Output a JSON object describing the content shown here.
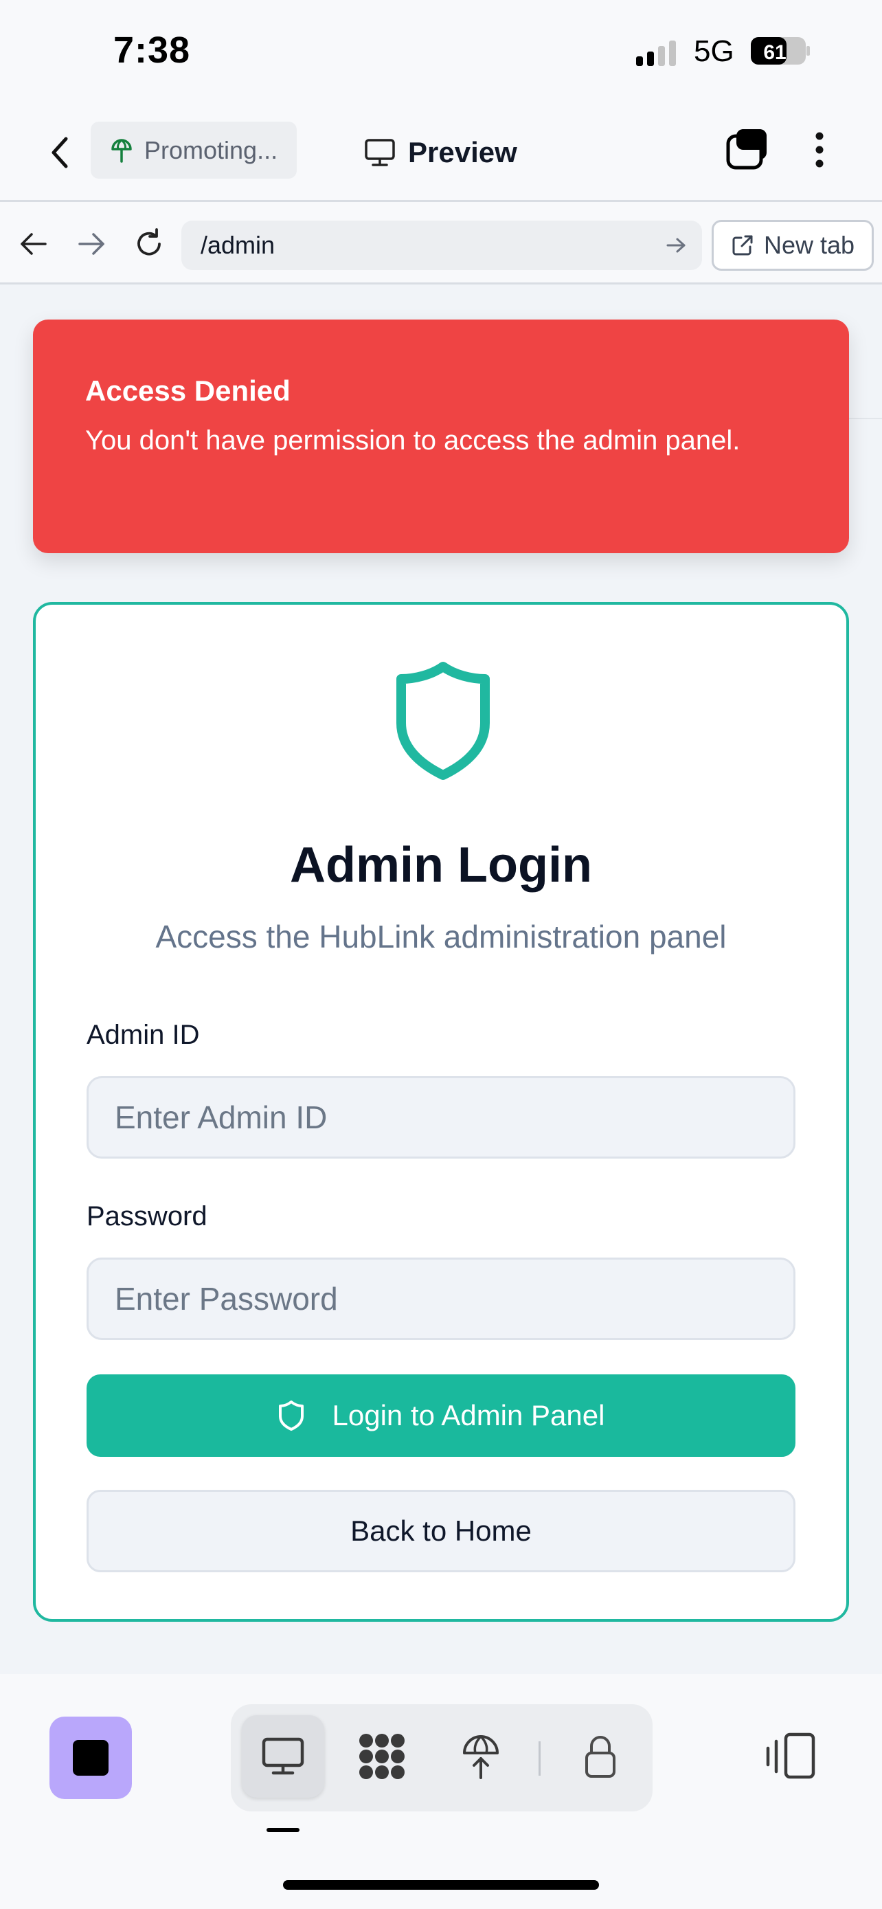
{
  "status_bar": {
    "time": "7:38",
    "network": "5G",
    "battery": "61"
  },
  "header": {
    "project_label": "Promoting...",
    "title": "Preview"
  },
  "browser": {
    "url": "/admin",
    "new_tab_label": "New tab"
  },
  "toast": {
    "title": "Access Denied",
    "message": "You don't have permission to access the admin panel."
  },
  "login": {
    "title": "Admin Login",
    "subtitle": "Access the HubLink administration panel",
    "admin_id_label": "Admin ID",
    "admin_id_placeholder": "Enter Admin ID",
    "admin_id_value": "",
    "password_label": "Password",
    "password_placeholder": "Enter Password",
    "password_value": "",
    "submit_label": "Login to Admin Panel",
    "back_label": "Back to Home"
  },
  "bottom_bar": {
    "items": [
      "monitor-icon",
      "apps-grid-icon",
      "deploy-icon",
      "lock-icon"
    ],
    "active": "monitor-icon"
  },
  "colors": {
    "accent": "#1ab99d",
    "danger": "#ef4444",
    "stop_button": "#b9a7fb"
  }
}
